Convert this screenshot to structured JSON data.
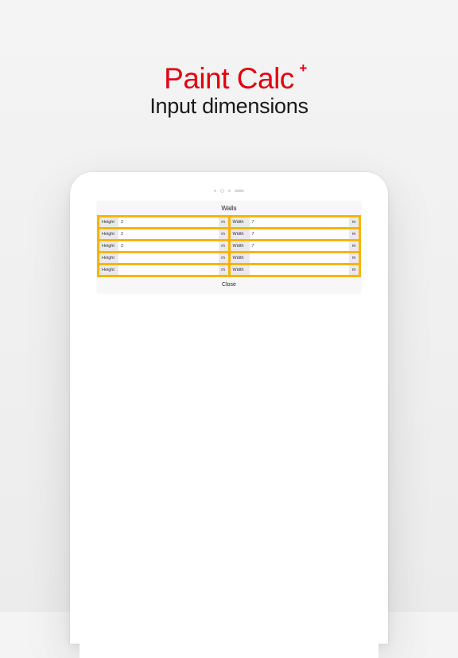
{
  "header": {
    "app_name": "Paint Calc",
    "plus": "+",
    "subtitle": "Input dimensions"
  },
  "colors": {
    "accent_red": "#e3000f",
    "accent_yellow": "#f7b500"
  },
  "walls": {
    "title": "Walls",
    "close_label": "Close",
    "height_label": "Height",
    "width_label": "Width",
    "unit": "m",
    "rows": [
      {
        "height": "2",
        "width": "7"
      },
      {
        "height": "2",
        "width": "7"
      },
      {
        "height": "2",
        "width": "7"
      },
      {
        "height": "",
        "width": ""
      },
      {
        "height": "",
        "width": ""
      }
    ]
  }
}
